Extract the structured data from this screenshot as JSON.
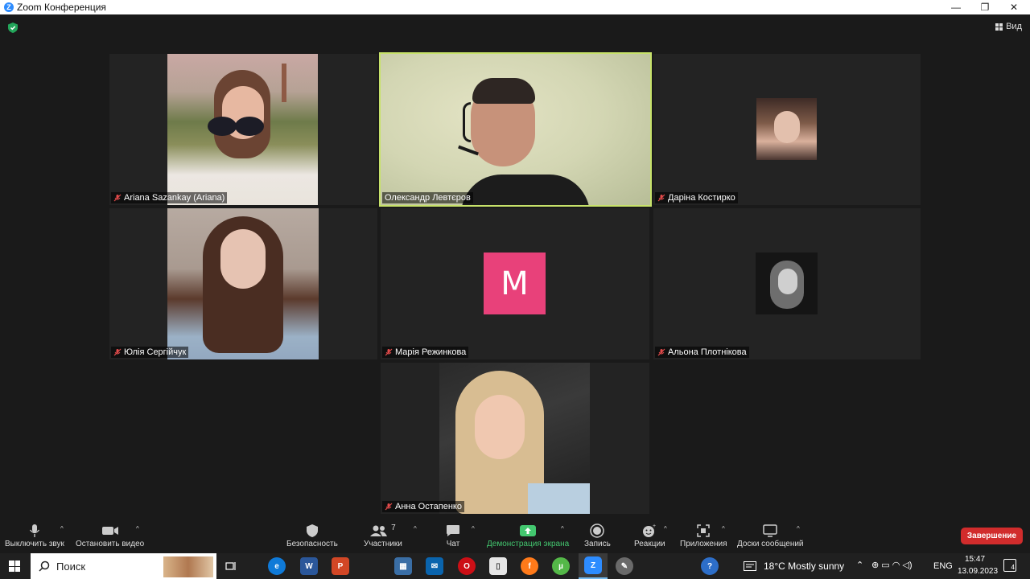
{
  "window": {
    "title": "Zoom Конференция",
    "controls": [
      "—",
      "❐",
      "✕"
    ]
  },
  "meeting": {
    "view_label": "Вид",
    "participants": [
      {
        "name": "Ariana Sazankay (Ariana)",
        "muted": true,
        "video": true
      },
      {
        "name": "Олександр Левтєров",
        "muted": false,
        "video": true,
        "active_speaker": true
      },
      {
        "name": "Даріна Костирко",
        "muted": true,
        "video": false
      },
      {
        "name": "Юлія Сергійчук",
        "muted": true,
        "video": true
      },
      {
        "name": "Марія Режинкова",
        "muted": true,
        "video": false,
        "avatar_letter": "M",
        "avatar_color": "#e8417a"
      },
      {
        "name": "Альона Плотнікова",
        "muted": true,
        "video": false
      },
      {
        "name": "Анна Остапенко",
        "muted": true,
        "video": true
      }
    ]
  },
  "toolbar": {
    "mute_label": "Выключить звук",
    "video_label": "Остановить видео",
    "security_label": "Безопасность",
    "participants_label": "Участники",
    "participants_count": "7",
    "chat_label": "Чат",
    "share_label": "Демонстрация экрана",
    "record_label": "Запись",
    "reactions_label": "Реакции",
    "apps_label": "Приложения",
    "whiteboard_label": "Доски сообщений",
    "end_label": "Завершение"
  },
  "taskbar": {
    "search_label": "Поиск",
    "weather": "18°C  Mostly sunny",
    "language": "ENG",
    "time": "15:47",
    "date": "13.09.2023",
    "notifications": "4"
  },
  "colors": {
    "accent_green": "#43c76f",
    "end_red": "#d12c2c",
    "active_border": "#c7e26a",
    "zoom_blue": "#2d8cff"
  }
}
